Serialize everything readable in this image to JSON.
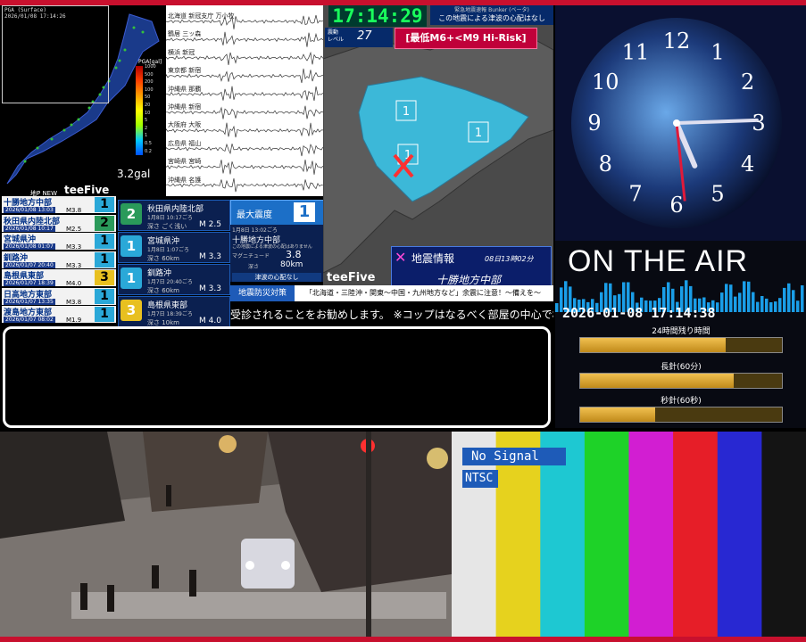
{
  "map_panel": {
    "station_header": "PGA (Surface)",
    "datetime": "2026/01/08 17:14:26",
    "pga_unit": "PGA[gal]",
    "pga_scale": [
      "1000",
      "500",
      "200",
      "100",
      "50",
      "20",
      "10",
      "5",
      "2",
      "1",
      "0.5",
      "0.2"
    ],
    "max_gal": "3.2gal",
    "label_new": "地P NEW",
    "logo": "teeFive",
    "stations": [
      "北海道 新冠支庁 万小牧",
      "鶴居 三ッ森",
      "横浜 新冠",
      "東京都 新宿",
      "沖縄県 那覇",
      "沖縄県 新宿",
      "大阪府 大阪",
      "広島県 福山",
      "宮崎県 宮崎",
      "沖縄県 名護"
    ]
  },
  "eq_list": [
    {
      "name": "十勝地方中部",
      "date": "2026/01/08 13:03",
      "mag": "M3.8",
      "scale": "1",
      "color": "#2aa8d8"
    },
    {
      "name": "秋田県内陸北部",
      "date": "2026/01/08 10:17",
      "mag": "M2.5",
      "scale": "2",
      "color": "#2a9a5a"
    },
    {
      "name": "宮城県沖",
      "date": "2026/01/08 01:07",
      "mag": "M3.3",
      "scale": "1",
      "color": "#2aa8d8"
    },
    {
      "name": "釧路沖",
      "date": "2026/01/07 20:40",
      "mag": "M3.3",
      "scale": "1",
      "color": "#2aa8d8"
    },
    {
      "name": "島根県東部",
      "date": "2026/01/07 18:39",
      "mag": "M4.0",
      "scale": "3",
      "color": "#e8c020"
    },
    {
      "name": "日高地方東部",
      "date": "2026/01/07 13:35",
      "mag": "M3.8",
      "scale": "1",
      "color": "#2aa8d8"
    },
    {
      "name": "渡島地方東部",
      "date": "2026/01/07 08:02",
      "mag": "M1.9",
      "scale": "1",
      "color": "#2aa8d8"
    }
  ],
  "detail_cards": [
    {
      "name": "秋田県内陸北部",
      "date": "1月8日 10:17ごろ",
      "depth": "深さ ごく浅い",
      "mag": "M 2.5",
      "scale": "2",
      "color": "#2a9a5a"
    },
    {
      "name": "宮城県沖",
      "date": "1月8日 1:07ごろ",
      "depth": "深さ 60km",
      "mag": "M 3.3",
      "scale": "1",
      "color": "#2aa8d8"
    },
    {
      "name": "釧路沖",
      "date": "1月7日 20:40ごろ",
      "depth": "深さ 60km",
      "mag": "M 3.3",
      "scale": "1",
      "color": "#2aa8d8"
    },
    {
      "name": "島根県東部",
      "date": "1月7日 18:39ごろ",
      "depth": "深さ 10km",
      "mag": "M 4.0",
      "scale": "3",
      "color": "#e8c020"
    }
  ],
  "max_intensity": {
    "label": "最大震度",
    "value": "1"
  },
  "quake_info": {
    "date": "1月8日 13:02ごろ",
    "region": "十勝地方中部",
    "tsunami_note": "この地震による津波の心配はありません",
    "mag_label": "マグニチュード",
    "mag_value": "3.8",
    "depth_label": "深さ",
    "depth_value": "80km",
    "tsunami_status": "津波の心配なし"
  },
  "prevent_bar": {
    "label": "地震防災対策",
    "message": "「北海道・三陸沖・関東〜中国・九州地方など」余震に注意！〜備えを〜"
  },
  "scroll_text": "受診されることをお勧めします。 ※コップはなるべく部屋の中心で机の",
  "map2": {
    "time": "17:14:29",
    "tsunami_tag_top": "緊急地震速報 Bunker (ベータ)",
    "tsunami_tag": "この地震による津波の心配はなし",
    "level_label": "震動\nレベル",
    "level_value": "27",
    "risk": "[最低M6+<M9 Hi-Risk]",
    "intensity_marks": [
      "1",
      "1",
      "1"
    ],
    "eq_title": "地震情報",
    "eq_time": "08日13時02分",
    "eq_region": "十勝地方中部",
    "logo": "teeFive"
  },
  "clock": {
    "numbers": [
      "12",
      "1",
      "2",
      "3",
      "4",
      "5",
      "6",
      "7",
      "8",
      "9",
      "10",
      "11"
    ],
    "hour_angle": 157,
    "minute_angle": 88,
    "second_angle": 174
  },
  "on_air": {
    "title": "ON THE AIR",
    "datetime": "2026-01-08 17:14:38",
    "bars": [
      {
        "label": "24時間残り時間",
        "fill": 0.72
      },
      {
        "label": "長針(60分)",
        "fill": 0.76
      },
      {
        "label": "秒針(60秒)",
        "fill": 0.37
      }
    ]
  },
  "color_bars": {
    "no_signal": "No Signal",
    "ntsc": "NTSC",
    "colors": [
      "#e6e6e6",
      "#e6d21e",
      "#1ec8d2",
      "#1ed228",
      "#d21ed2",
      "#e61e28",
      "#2828d2",
      "#141414"
    ]
  }
}
